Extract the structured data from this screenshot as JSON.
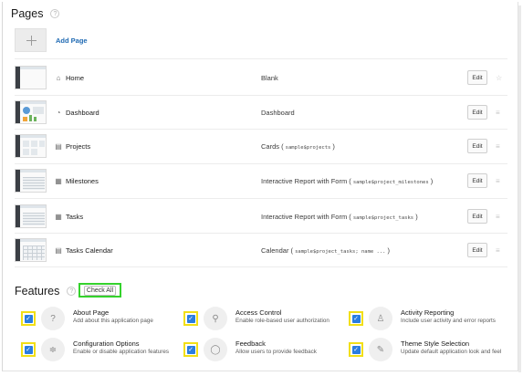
{
  "pages_section": {
    "title": "Pages",
    "help": "?",
    "add_label": "Add Page"
  },
  "pages": [
    {
      "name": "Home",
      "icon": "home-icon",
      "glyph": "⌂",
      "type": "Blank",
      "type_detail": "",
      "edit": "Edit",
      "handle": "☆"
    },
    {
      "name": "Dashboard",
      "icon": "dashboard-icon",
      "glyph": "◔",
      "type": "Dashboard",
      "type_detail": "",
      "edit": "Edit",
      "handle": "≡"
    },
    {
      "name": "Projects",
      "icon": "cards-icon",
      "glyph": "▤",
      "type": "Cards ( ",
      "type_detail": "sample$projects",
      "type_end": " )",
      "edit": "Edit",
      "handle": "≡"
    },
    {
      "name": "Milestones",
      "icon": "table-icon",
      "glyph": "▦",
      "type": "Interactive Report with Form ( ",
      "type_detail": "sample$project_milestones",
      "type_end": " )",
      "edit": "Edit",
      "handle": "≡"
    },
    {
      "name": "Tasks",
      "icon": "table-icon",
      "glyph": "▦",
      "type": "Interactive Report with Form ( ",
      "type_detail": "sample$project_tasks",
      "type_end": " )",
      "edit": "Edit",
      "handle": "≡"
    },
    {
      "name": "Tasks Calendar",
      "icon": "calendar-icon",
      "glyph": "▤",
      "type": "Calendar ( ",
      "type_detail": "sample$project_tasks; name ...",
      "type_end": " )",
      "edit": "Edit",
      "handle": "≡"
    }
  ],
  "features_section": {
    "title": "Features",
    "help": "?",
    "check_all": "Check All"
  },
  "features": [
    {
      "title": "About Page",
      "desc": "Add about this application page",
      "icon": "question-icon",
      "glyph": "?"
    },
    {
      "title": "Access Control",
      "desc": "Enable role-based user authorization",
      "icon": "key-icon",
      "glyph": "⚲"
    },
    {
      "title": "Activity Reporting",
      "desc": "Include user activity and error reports",
      "icon": "user-activity-icon",
      "glyph": "♙"
    },
    {
      "title": "Configuration Options",
      "desc": "Enable or disable application features",
      "icon": "sliders-icon",
      "glyph": "≑"
    },
    {
      "title": "Feedback",
      "desc": "Allow users to provide feedback",
      "icon": "chat-bubble-icon",
      "glyph": "◯"
    },
    {
      "title": "Theme Style Selection",
      "desc": "Update default application look and feel",
      "icon": "brush-icon",
      "glyph": "✎"
    }
  ]
}
